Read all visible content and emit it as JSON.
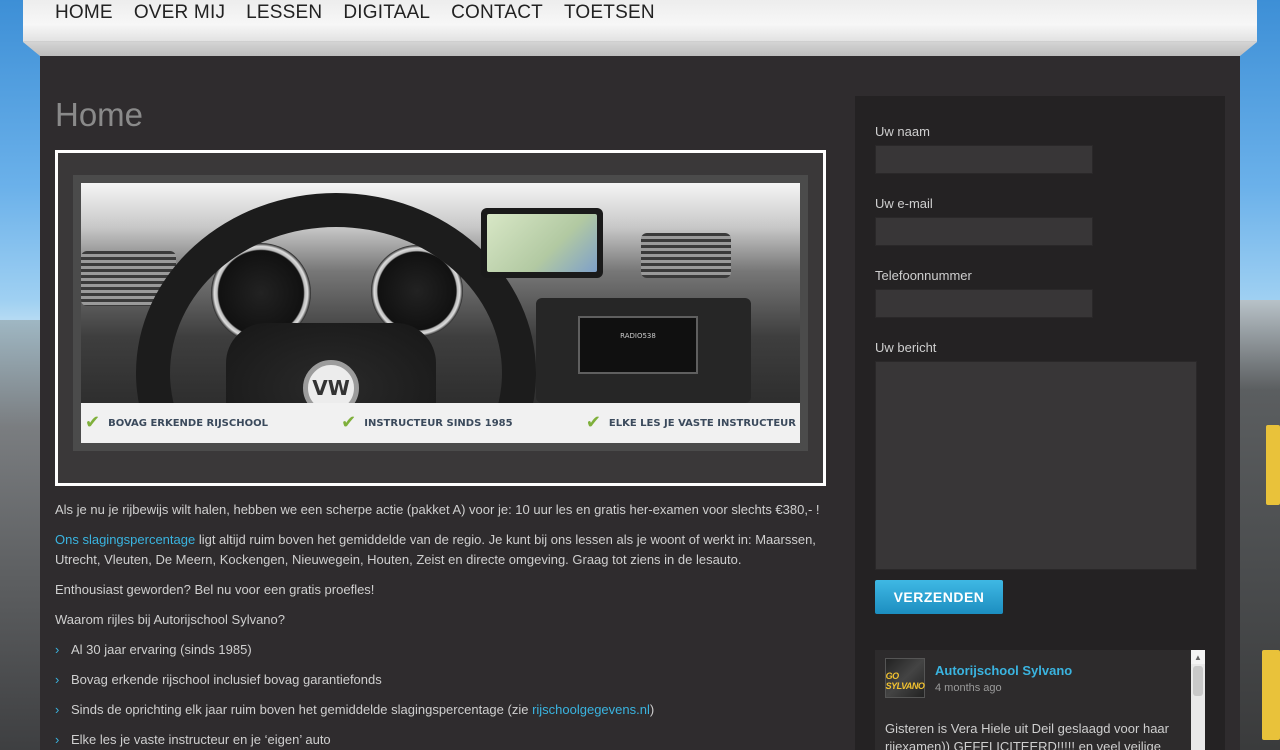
{
  "nav": {
    "items": [
      "HOME",
      "OVER MIJ",
      "LESSEN",
      "DIGITAAL",
      "CONTACT",
      "TOETSEN"
    ]
  },
  "main": {
    "title": "Home",
    "hero": {
      "features": [
        "BOVAG ERKENDE RIJSCHOOL",
        "INSTRUCTEUR SINDS 1985",
        "ELKE LES JE VASTE INSTRUCTEUR"
      ],
      "logo_text": "VW",
      "radio_text": "RADIO538"
    },
    "paragraph1": "Als je nu je rijbewijs wilt halen, hebben we een scherpe actie (pakket A) voor je: 10 uur les en gratis her-examen voor slechts €380,- !",
    "paragraph2_link": "Ons slagingspercentage",
    "paragraph2_rest": " ligt altijd ruim boven het gemiddelde van de regio. Je kunt bij ons lessen als je woont of werkt in: Maarssen, Utrecht, Vleuten, De Meern, Kockengen, Nieuwegein, Houten, Zeist en directe omgeving. Graag tot ziens in de lesauto.",
    "paragraph3": "Enthousiast geworden? Bel nu voor een gratis proefles!",
    "paragraph4": "Waarom rijles bij Autorijschool Sylvano?",
    "bullets": [
      "Al 30 jaar ervaring (sinds 1985)",
      "Bovag erkende rijschool inclusief bovag garantiefonds",
      "Sinds de oprichting elk jaar ruim boven het gemiddelde slagingspercentage (zie ",
      "Elke les je vaste instructeur en je ‘eigen’ auto"
    ],
    "bullet3_link": "rijschoolgegevens.nl",
    "bullet3_end": ")"
  },
  "sidebar": {
    "form": {
      "name_label": "Uw naam",
      "email_label": "Uw e-mail",
      "phone_label": "Telefoonnummer",
      "message_label": "Uw bericht",
      "submit_label": "VERZENDEN"
    },
    "feed": {
      "name": "Autorijschool Sylvano",
      "time": "4 months ago",
      "avatar_text": "GO SYLVANO",
      "text": "Gisteren is Vera Hiele uit Deil geslaagd voor haar rijexamen)) GEFELICITEERD!!!!! en veel veilige"
    }
  }
}
